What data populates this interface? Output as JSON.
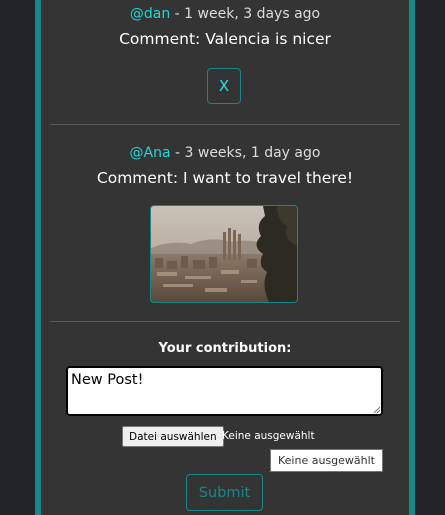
{
  "comments": [
    {
      "user": "@dan",
      "meta_separator": " - ",
      "time": "1 week, 3 days ago",
      "text": "Comment: Valencia is nicer",
      "delete_label": "X"
    },
    {
      "user": "@Ana",
      "meta_separator": " - ",
      "time": "3 weeks, 1 day ago",
      "text": "Comment: I want to travel there!"
    }
  ],
  "form": {
    "label": "Your contribution:",
    "post_value": "New Post!",
    "file_button_label": "Datei auswählen",
    "file_status": "Keine ausgewählt",
    "tooltip": "Keine ausgewählt",
    "submit_label": "Submit"
  },
  "colors": {
    "accent": "#17888a",
    "username": "#1fd8d8",
    "panel": "#343434",
    "background": "#212529"
  }
}
